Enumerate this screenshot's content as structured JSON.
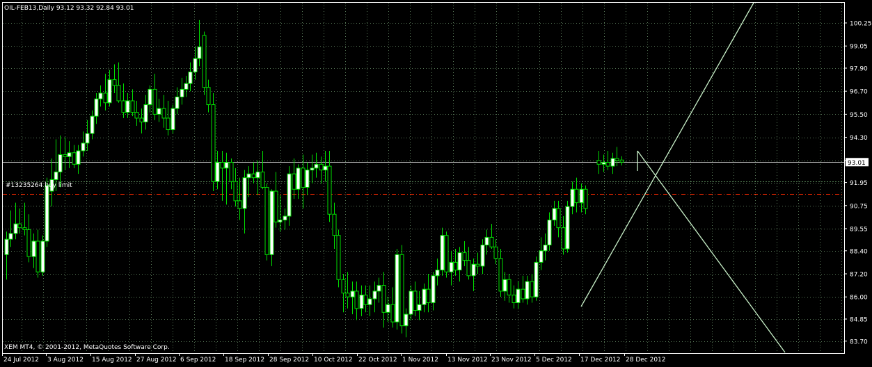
{
  "chart_data": {
    "type": "candlestick",
    "title": "OIL-FEB13,Daily  93.12 93.32 92.84 93.01",
    "symbol": "OIL-FEB13",
    "timeframe": "Daily",
    "ohlc_header": "93.12 93.32 92.84 93.01",
    "footer": "XEM MT4, © 2001-2012, MetaQuotes Software Corp.",
    "order_label": "#13235264 buy limit",
    "bid_label": "93.01",
    "bid_price": 93.01,
    "order_price": 92.0,
    "stop_price": 91.35,
    "ylim": [
      83.6,
      101.2
    ],
    "y_ticks": [
      "100.25",
      "99.05",
      "97.90",
      "96.70",
      "95.50",
      "94.30",
      "93.10",
      "91.95",
      "90.75",
      "89.55",
      "88.40",
      "87.20",
      "86.00",
      "84.85",
      "83.70"
    ],
    "x_ticks": [
      "24 Jul 2012",
      "3 Aug 2012",
      "15 Aug 2012",
      "27 Aug 2012",
      "6 Sep 2012",
      "18 Sep 2012",
      "28 Sep 2012",
      "10 Oct 2012",
      "22 Oct 2012",
      "1 Nov 2012",
      "13 Nov 2012",
      "23 Nov 2012",
      "5 Dec 2012",
      "17 Dec 2012",
      "28 Dec 2012"
    ],
    "grid": true,
    "colors": {
      "background": "#000000",
      "grid": "#5a7a5a",
      "frame": "#ffffff",
      "text": "#ffffff",
      "bull_body": "#ffffff",
      "bear_body": "#000000",
      "wick": "#00e000",
      "trendline": "#c8f0c8",
      "order_line": "#5c8a5c",
      "stop_line": "#ff2a00",
      "bid_line": "#ffffff"
    },
    "candles": [
      {
        "o": 88.2,
        "h": 89.4,
        "l": 86.9,
        "c": 89.0
      },
      {
        "o": 89.0,
        "h": 90.5,
        "l": 88.6,
        "c": 89.3
      },
      {
        "o": 89.3,
        "h": 90.9,
        "l": 89.0,
        "c": 89.8
      },
      {
        "o": 89.8,
        "h": 90.6,
        "l": 89.3,
        "c": 89.6
      },
      {
        "o": 89.6,
        "h": 90.9,
        "l": 89.2,
        "c": 89.5
      },
      {
        "o": 89.5,
        "h": 90.3,
        "l": 87.8,
        "c": 88.1
      },
      {
        "o": 88.1,
        "h": 89.3,
        "l": 87.5,
        "c": 88.9
      },
      {
        "o": 88.9,
        "h": 89.5,
        "l": 87.0,
        "c": 87.3
      },
      {
        "o": 87.3,
        "h": 89.2,
        "l": 87.1,
        "c": 88.9
      },
      {
        "o": 88.9,
        "h": 92.2,
        "l": 88.6,
        "c": 91.8
      },
      {
        "o": 91.5,
        "h": 93.2,
        "l": 90.7,
        "c": 92.1
      },
      {
        "o": 92.1,
        "h": 94.2,
        "l": 91.5,
        "c": 92.5
      },
      {
        "o": 92.5,
        "h": 94.4,
        "l": 91.7,
        "c": 93.4
      },
      {
        "o": 93.4,
        "h": 94.3,
        "l": 92.6,
        "c": 93.3
      },
      {
        "o": 93.3,
        "h": 94.1,
        "l": 92.7,
        "c": 93.5
      },
      {
        "o": 93.5,
        "h": 93.9,
        "l": 92.7,
        "c": 92.9
      },
      {
        "o": 92.9,
        "h": 93.9,
        "l": 92.4,
        "c": 93.6
      },
      {
        "o": 93.6,
        "h": 94.6,
        "l": 93.3,
        "c": 94.0
      },
      {
        "o": 94.0,
        "h": 95.2,
        "l": 93.6,
        "c": 94.5
      },
      {
        "o": 94.5,
        "h": 95.7,
        "l": 94.2,
        "c": 95.4
      },
      {
        "o": 95.4,
        "h": 96.6,
        "l": 95.0,
        "c": 96.3
      },
      {
        "o": 96.3,
        "h": 97.0,
        "l": 95.9,
        "c": 96.6
      },
      {
        "o": 96.6,
        "h": 97.6,
        "l": 95.7,
        "c": 96.1
      },
      {
        "o": 96.1,
        "h": 97.8,
        "l": 95.9,
        "c": 97.3
      },
      {
        "o": 97.3,
        "h": 98.1,
        "l": 96.6,
        "c": 97.0
      },
      {
        "o": 97.0,
        "h": 98.2,
        "l": 96.1,
        "c": 96.2
      },
      {
        "o": 96.2,
        "h": 97.1,
        "l": 95.3,
        "c": 95.6
      },
      {
        "o": 95.6,
        "h": 96.6,
        "l": 95.3,
        "c": 96.2
      },
      {
        "o": 96.2,
        "h": 96.8,
        "l": 95.4,
        "c": 95.6
      },
      {
        "o": 95.6,
        "h": 96.2,
        "l": 94.9,
        "c": 95.3
      },
      {
        "o": 95.3,
        "h": 95.8,
        "l": 94.5,
        "c": 95.1
      },
      {
        "o": 95.1,
        "h": 96.5,
        "l": 94.7,
        "c": 96.0
      },
      {
        "o": 96.0,
        "h": 97.0,
        "l": 95.6,
        "c": 96.8
      },
      {
        "o": 96.8,
        "h": 97.6,
        "l": 95.2,
        "c": 95.5
      },
      {
        "o": 95.5,
        "h": 96.3,
        "l": 95.1,
        "c": 95.8
      },
      {
        "o": 95.8,
        "h": 96.5,
        "l": 94.8,
        "c": 95.3
      },
      {
        "o": 95.3,
        "h": 96.2,
        "l": 94.4,
        "c": 94.7
      },
      {
        "o": 94.7,
        "h": 96.0,
        "l": 94.5,
        "c": 95.8
      },
      {
        "o": 95.8,
        "h": 96.9,
        "l": 95.5,
        "c": 96.4
      },
      {
        "o": 96.4,
        "h": 97.4,
        "l": 96.0,
        "c": 96.8
      },
      {
        "o": 96.8,
        "h": 97.5,
        "l": 96.4,
        "c": 97.1
      },
      {
        "o": 97.1,
        "h": 98.2,
        "l": 96.7,
        "c": 97.7
      },
      {
        "o": 97.7,
        "h": 99.0,
        "l": 97.3,
        "c": 98.4
      },
      {
        "o": 98.4,
        "h": 100.4,
        "l": 98.0,
        "c": 99.0
      },
      {
        "o": 99.6,
        "h": 99.8,
        "l": 96.5,
        "c": 96.9
      },
      {
        "o": 96.9,
        "h": 97.3,
        "l": 95.6,
        "c": 96.0
      },
      {
        "o": 96.0,
        "h": 96.6,
        "l": 91.5,
        "c": 92.0
      },
      {
        "o": 92.0,
        "h": 93.6,
        "l": 91.6,
        "c": 93.0
      },
      {
        "o": 93.0,
        "h": 93.6,
        "l": 91.0,
        "c": 92.7
      },
      {
        "o": 92.7,
        "h": 93.5,
        "l": 90.8,
        "c": 93.0
      },
      {
        "o": 93.0,
        "h": 93.2,
        "l": 91.6,
        "c": 92.0
      },
      {
        "o": 92.0,
        "h": 92.7,
        "l": 90.7,
        "c": 91.0
      },
      {
        "o": 91.0,
        "h": 92.2,
        "l": 90.0,
        "c": 90.6
      },
      {
        "o": 90.6,
        "h": 92.6,
        "l": 89.3,
        "c": 92.2
      },
      {
        "o": 92.2,
        "h": 92.8,
        "l": 91.2,
        "c": 92.4
      },
      {
        "o": 92.4,
        "h": 93.0,
        "l": 91.9,
        "c": 92.2
      },
      {
        "o": 92.2,
        "h": 93.1,
        "l": 91.3,
        "c": 92.5
      },
      {
        "o": 92.5,
        "h": 93.6,
        "l": 91.6,
        "c": 91.7
      },
      {
        "o": 91.7,
        "h": 91.9,
        "l": 87.9,
        "c": 88.2
      },
      {
        "o": 88.2,
        "h": 91.6,
        "l": 87.6,
        "c": 91.5
      },
      {
        "o": 91.5,
        "h": 92.5,
        "l": 89.6,
        "c": 89.9
      },
      {
        "o": 89.9,
        "h": 91.3,
        "l": 89.4,
        "c": 90.0
      },
      {
        "o": 90.0,
        "h": 90.6,
        "l": 89.5,
        "c": 90.2
      },
      {
        "o": 90.2,
        "h": 92.8,
        "l": 89.7,
        "c": 92.4
      },
      {
        "o": 92.4,
        "h": 93.2,
        "l": 91.1,
        "c": 91.6
      },
      {
        "o": 91.6,
        "h": 92.9,
        "l": 91.1,
        "c": 92.7
      },
      {
        "o": 92.7,
        "h": 93.4,
        "l": 90.6,
        "c": 91.7
      },
      {
        "o": 91.7,
        "h": 93.0,
        "l": 91.3,
        "c": 92.6
      },
      {
        "o": 92.6,
        "h": 93.4,
        "l": 91.9,
        "c": 92.7
      },
      {
        "o": 92.7,
        "h": 93.5,
        "l": 92.2,
        "c": 92.9
      },
      {
        "o": 92.9,
        "h": 93.3,
        "l": 91.9,
        "c": 92.6
      },
      {
        "o": 92.6,
        "h": 93.6,
        "l": 92.0,
        "c": 92.8
      },
      {
        "o": 92.8,
        "h": 93.6,
        "l": 89.9,
        "c": 90.3
      },
      {
        "o": 90.3,
        "h": 90.9,
        "l": 88.5,
        "c": 89.2
      },
      {
        "o": 89.2,
        "h": 89.5,
        "l": 86.5,
        "c": 86.9
      },
      {
        "o": 86.9,
        "h": 87.2,
        "l": 85.2,
        "c": 86.2
      },
      {
        "o": 86.2,
        "h": 87.3,
        "l": 85.4,
        "c": 86.0
      },
      {
        "o": 86.0,
        "h": 86.8,
        "l": 85.1,
        "c": 86.3
      },
      {
        "o": 86.3,
        "h": 86.8,
        "l": 84.8,
        "c": 85.4
      },
      {
        "o": 85.4,
        "h": 86.6,
        "l": 85.0,
        "c": 86.1
      },
      {
        "o": 86.1,
        "h": 86.6,
        "l": 85.2,
        "c": 85.6
      },
      {
        "o": 85.6,
        "h": 86.6,
        "l": 85.0,
        "c": 85.9
      },
      {
        "o": 85.9,
        "h": 86.8,
        "l": 85.2,
        "c": 86.3
      },
      {
        "o": 86.3,
        "h": 87.0,
        "l": 85.7,
        "c": 86.6
      },
      {
        "o": 86.6,
        "h": 87.3,
        "l": 84.4,
        "c": 85.2
      },
      {
        "o": 85.2,
        "h": 86.0,
        "l": 84.7,
        "c": 85.6
      },
      {
        "o": 85.6,
        "h": 86.5,
        "l": 84.4,
        "c": 84.7
      },
      {
        "o": 84.7,
        "h": 88.5,
        "l": 84.3,
        "c": 88.2
      },
      {
        "o": 88.2,
        "h": 88.7,
        "l": 84.1,
        "c": 84.5
      },
      {
        "o": 84.5,
        "h": 85.4,
        "l": 83.9,
        "c": 85.1
      },
      {
        "o": 85.1,
        "h": 86.6,
        "l": 84.8,
        "c": 86.3
      },
      {
        "o": 86.3,
        "h": 86.8,
        "l": 85.0,
        "c": 85.3
      },
      {
        "o": 85.3,
        "h": 86.3,
        "l": 84.8,
        "c": 85.6
      },
      {
        "o": 85.6,
        "h": 86.7,
        "l": 85.2,
        "c": 86.4
      },
      {
        "o": 86.4,
        "h": 87.2,
        "l": 85.2,
        "c": 85.7
      },
      {
        "o": 85.7,
        "h": 87.3,
        "l": 85.3,
        "c": 87.1
      },
      {
        "o": 87.1,
        "h": 88.0,
        "l": 86.6,
        "c": 87.4
      },
      {
        "o": 87.4,
        "h": 89.6,
        "l": 87.1,
        "c": 89.2
      },
      {
        "o": 89.2,
        "h": 89.4,
        "l": 87.0,
        "c": 87.3
      },
      {
        "o": 87.3,
        "h": 88.4,
        "l": 86.6,
        "c": 87.8
      },
      {
        "o": 87.8,
        "h": 88.5,
        "l": 87.1,
        "c": 87.4
      },
      {
        "o": 87.4,
        "h": 88.6,
        "l": 86.8,
        "c": 88.3
      },
      {
        "o": 88.3,
        "h": 88.9,
        "l": 87.6,
        "c": 87.9
      },
      {
        "o": 87.9,
        "h": 88.6,
        "l": 86.9,
        "c": 87.1
      },
      {
        "o": 87.1,
        "h": 88.0,
        "l": 86.3,
        "c": 87.7
      },
      {
        "o": 87.7,
        "h": 88.3,
        "l": 87.2,
        "c": 87.6
      },
      {
        "o": 87.6,
        "h": 89.0,
        "l": 87.2,
        "c": 88.7
      },
      {
        "o": 88.7,
        "h": 89.5,
        "l": 88.2,
        "c": 89.1
      },
      {
        "o": 89.1,
        "h": 89.8,
        "l": 88.5,
        "c": 88.6
      },
      {
        "o": 88.6,
        "h": 89.0,
        "l": 87.7,
        "c": 88.0
      },
      {
        "o": 88.0,
        "h": 88.5,
        "l": 86.0,
        "c": 86.3
      },
      {
        "o": 86.3,
        "h": 87.3,
        "l": 85.8,
        "c": 86.9
      },
      {
        "o": 86.9,
        "h": 87.2,
        "l": 85.7,
        "c": 86.1
      },
      {
        "o": 86.1,
        "h": 86.6,
        "l": 85.4,
        "c": 85.7
      },
      {
        "o": 85.7,
        "h": 86.8,
        "l": 85.4,
        "c": 86.4
      },
      {
        "o": 86.4,
        "h": 87.1,
        "l": 85.7,
        "c": 85.9
      },
      {
        "o": 85.9,
        "h": 87.1,
        "l": 85.6,
        "c": 86.8
      },
      {
        "o": 86.8,
        "h": 87.2,
        "l": 85.7,
        "c": 86.0
      },
      {
        "o": 86.0,
        "h": 88.1,
        "l": 85.8,
        "c": 87.8
      },
      {
        "o": 87.8,
        "h": 89.1,
        "l": 87.4,
        "c": 88.4
      },
      {
        "o": 88.4,
        "h": 89.3,
        "l": 87.9,
        "c": 88.7
      },
      {
        "o": 88.7,
        "h": 90.4,
        "l": 88.4,
        "c": 90.0
      },
      {
        "o": 90.0,
        "h": 91.0,
        "l": 89.7,
        "c": 90.6
      },
      {
        "o": 90.6,
        "h": 91.0,
        "l": 89.1,
        "c": 89.6
      },
      {
        "o": 89.6,
        "h": 90.2,
        "l": 88.2,
        "c": 88.5
      },
      {
        "o": 88.5,
        "h": 91.0,
        "l": 88.3,
        "c": 90.7
      },
      {
        "o": 90.7,
        "h": 92.0,
        "l": 90.3,
        "c": 91.6
      },
      {
        "o": 91.6,
        "h": 92.2,
        "l": 90.4,
        "c": 90.9
      },
      {
        "o": 90.9,
        "h": 91.9,
        "l": 90.4,
        "c": 91.6
      },
      {
        "o": 91.6,
        "h": 91.8,
        "l": 90.3,
        "c": 90.6
      },
      {
        "o": null
      },
      {
        "o": null
      },
      {
        "o": 93.1,
        "h": 93.6,
        "l": 92.4,
        "c": 92.9
      },
      {
        "o": 92.9,
        "h": 93.4,
        "l": 92.5,
        "c": 93.0
      },
      {
        "o": 93.0,
        "h": 93.6,
        "l": 92.6,
        "c": 92.8
      },
      {
        "o": 92.8,
        "h": 93.5,
        "l": 92.4,
        "c": 93.2
      },
      {
        "o": 93.2,
        "h": 93.8,
        "l": 92.8,
        "c": 93.1
      },
      {
        "o": 93.12,
        "h": 93.32,
        "l": 92.84,
        "c": 93.01
      }
    ],
    "lines": [
      {
        "name": "fan-up",
        "x1": 835,
        "y1": 441,
        "x2": 1083,
        "y2": 4
      },
      {
        "name": "fan-down",
        "x1": 916,
        "y1": 217,
        "x2": 1128,
        "y2": 507
      },
      {
        "name": "pitch-handle",
        "x1": 916,
        "y1": 217,
        "x2": 916,
        "y2": 246
      }
    ]
  }
}
